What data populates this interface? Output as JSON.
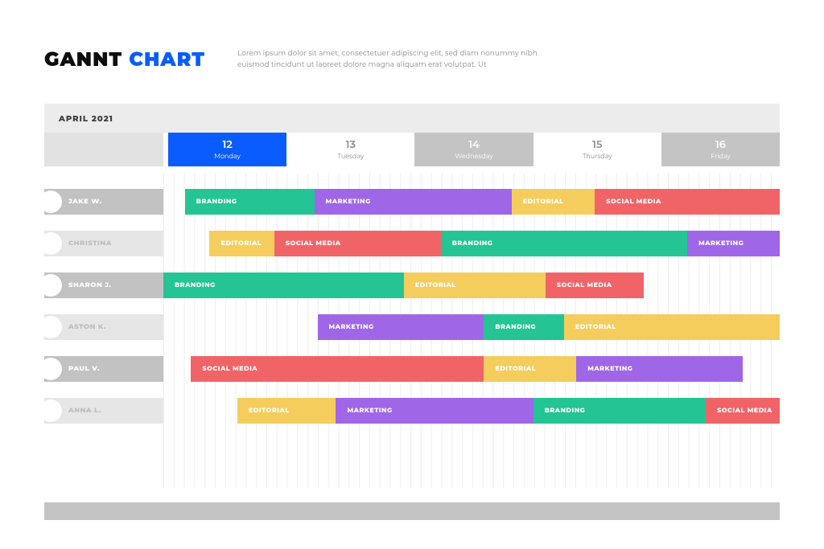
{
  "header": {
    "title_a": "GANNT",
    "title_b": "CHART",
    "desc": "Lorem ipsum dolor sit amet, consectetuer adipiscing elit, sed diam nonummy nibh euismod tincidunt ut laoreet dolore magna aliquam erat volutpat. Ut"
  },
  "month": "APRIL 2021",
  "days": [
    {
      "num": "12",
      "name": "Monday",
      "style": "selected"
    },
    {
      "num": "13",
      "name": "Tuesday",
      "style": ""
    },
    {
      "num": "14",
      "name": "Wednesday",
      "style": "alt"
    },
    {
      "num": "15",
      "name": "Thursday",
      "style": ""
    },
    {
      "num": "16",
      "name": "Friday",
      "style": "alt"
    }
  ],
  "people": [
    {
      "name": "JAKE W.",
      "style": ""
    },
    {
      "name": "CHRISTINA",
      "style": "light"
    },
    {
      "name": "SHARON J.",
      "style": ""
    },
    {
      "name": "ASTON K.",
      "style": "light"
    },
    {
      "name": "PAUL V.",
      "style": ""
    },
    {
      "name": "ANNA L.",
      "style": "light"
    }
  ],
  "colors": {
    "green": "#24c494",
    "purple": "#a066e8",
    "yellow": "#f5cd5d",
    "red": "#f06468"
  },
  "tasks": [
    {
      "row": 0,
      "label": "BRANDING",
      "color": "green",
      "start": 3.5,
      "end": 24.5
    },
    {
      "row": 0,
      "label": "MARKETING",
      "color": "purple",
      "start": 24.5,
      "end": 56.5
    },
    {
      "row": 0,
      "label": "EDITORIAL",
      "color": "yellow",
      "start": 56.5,
      "end": 70
    },
    {
      "row": 0,
      "label": "SOCIAL MEDIA",
      "color": "red",
      "start": 70,
      "end": 100
    },
    {
      "row": 1,
      "label": "EDITORIAL",
      "color": "yellow",
      "start": 7.5,
      "end": 18
    },
    {
      "row": 1,
      "label": "SOCIAL MEDIA",
      "color": "red",
      "start": 18,
      "end": 45
    },
    {
      "row": 1,
      "label": "BRANDING",
      "color": "green",
      "start": 45,
      "end": 85
    },
    {
      "row": 1,
      "label": "MARKETING",
      "color": "purple",
      "start": 85,
      "end": 100
    },
    {
      "row": 2,
      "label": "BRANDING",
      "color": "green",
      "start": 0,
      "end": 39
    },
    {
      "row": 2,
      "label": "EDITORIAL",
      "color": "yellow",
      "start": 39,
      "end": 62
    },
    {
      "row": 2,
      "label": "SOCIAL MEDIA",
      "color": "red",
      "start": 62,
      "end": 78
    },
    {
      "row": 3,
      "label": "MARKETING",
      "color": "purple",
      "start": 25,
      "end": 52
    },
    {
      "row": 3,
      "label": "BRANDING",
      "color": "green",
      "start": 52,
      "end": 65
    },
    {
      "row": 3,
      "label": "EDITORIAL",
      "color": "yellow",
      "start": 65,
      "end": 100
    },
    {
      "row": 4,
      "label": "SOCIAL MEDIA",
      "color": "red",
      "start": 4.5,
      "end": 52
    },
    {
      "row": 4,
      "label": "EDITORIAL",
      "color": "yellow",
      "start": 52,
      "end": 67
    },
    {
      "row": 4,
      "label": "MARKETING",
      "color": "purple",
      "start": 67,
      "end": 94
    },
    {
      "row": 5,
      "label": "EDITORIAL",
      "color": "yellow",
      "start": 12,
      "end": 28
    },
    {
      "row": 5,
      "label": "MARKETING",
      "color": "purple",
      "start": 28,
      "end": 60
    },
    {
      "row": 5,
      "label": "BRANDING",
      "color": "green",
      "start": 60,
      "end": 88
    },
    {
      "row": 5,
      "label": "SOCIAL MEDIA",
      "color": "red",
      "start": 88,
      "end": 100
    }
  ],
  "chart_data": {
    "type": "gantt",
    "title": "GANNT CHART",
    "month": "APRIL 2021",
    "day_range": [
      12,
      16
    ],
    "day_labels": [
      "Monday",
      "Tuesday",
      "Wednesday",
      "Thursday",
      "Friday"
    ],
    "task_categories": [
      "BRANDING",
      "MARKETING",
      "EDITORIAL",
      "SOCIAL MEDIA"
    ],
    "category_colors": {
      "BRANDING": "#24c494",
      "MARKETING": "#a066e8",
      "EDITORIAL": "#f5cd5d",
      "SOCIAL MEDIA": "#f06468"
    },
    "rows": [
      {
        "person": "JAKE W.",
        "segments": [
          {
            "label": "BRANDING",
            "start": 12.15,
            "end": 13.2
          },
          {
            "label": "MARKETING",
            "start": 13.2,
            "end": 14.8
          },
          {
            "label": "EDITORIAL",
            "start": 14.8,
            "end": 15.5
          },
          {
            "label": "SOCIAL MEDIA",
            "start": 15.5,
            "end": 17.0
          }
        ]
      },
      {
        "person": "CHRISTINA",
        "segments": [
          {
            "label": "EDITORIAL",
            "start": 12.35,
            "end": 12.9
          },
          {
            "label": "SOCIAL MEDIA",
            "start": 12.9,
            "end": 14.25
          },
          {
            "label": "BRANDING",
            "start": 14.25,
            "end": 16.25
          },
          {
            "label": "MARKETING",
            "start": 16.25,
            "end": 17.0
          }
        ]
      },
      {
        "person": "SHARON J.",
        "segments": [
          {
            "label": "BRANDING",
            "start": 12.0,
            "end": 13.95
          },
          {
            "label": "EDITORIAL",
            "start": 13.95,
            "end": 15.1
          },
          {
            "label": "SOCIAL MEDIA",
            "start": 15.1,
            "end": 15.9
          }
        ]
      },
      {
        "person": "ASTON K.",
        "segments": [
          {
            "label": "MARKETING",
            "start": 13.25,
            "end": 14.6
          },
          {
            "label": "BRANDING",
            "start": 14.6,
            "end": 15.25
          },
          {
            "label": "EDITORIAL",
            "start": 15.25,
            "end": 17.0
          }
        ]
      },
      {
        "person": "PAUL V.",
        "segments": [
          {
            "label": "SOCIAL MEDIA",
            "start": 12.2,
            "end": 14.6
          },
          {
            "label": "EDITORIAL",
            "start": 14.6,
            "end": 15.35
          },
          {
            "label": "MARKETING",
            "start": 15.35,
            "end": 16.7
          }
        ]
      },
      {
        "person": "ANNA L.",
        "segments": [
          {
            "label": "EDITORIAL",
            "start": 12.6,
            "end": 13.4
          },
          {
            "label": "MARKETING",
            "start": 13.4,
            "end": 15.0
          },
          {
            "label": "BRANDING",
            "start": 15.0,
            "end": 16.4
          },
          {
            "label": "SOCIAL MEDIA",
            "start": 16.4,
            "end": 17.0
          }
        ]
      }
    ]
  }
}
